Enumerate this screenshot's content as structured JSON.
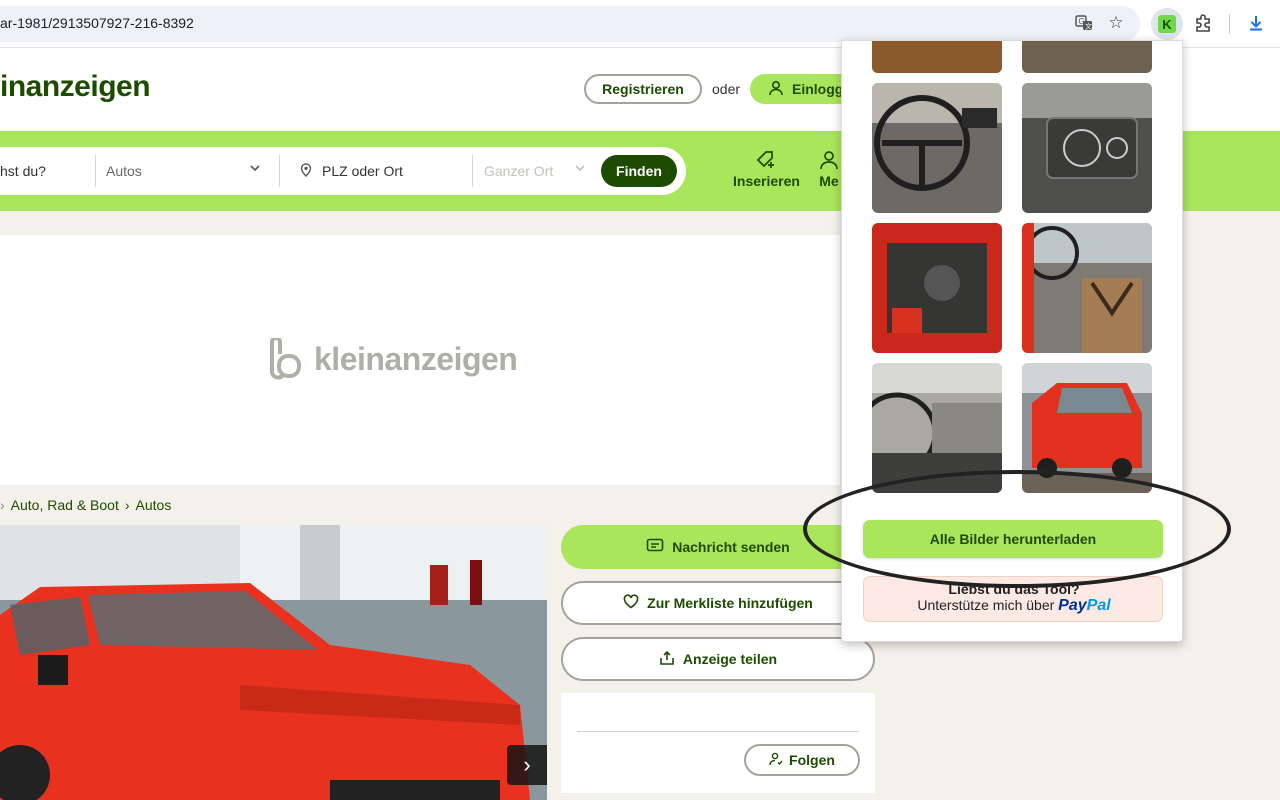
{
  "browser": {
    "url": "ar-1981/2913507927-216-8392",
    "icons": [
      "translate-icon",
      "bookmark-star-icon",
      "kleinanzeigen-extension-icon",
      "extensions-puzzle-icon",
      "download-icon"
    ],
    "extension_letter": "K"
  },
  "header": {
    "logo": "inanzeigen",
    "register_label": "Registrieren",
    "or_label": "oder",
    "login_label": "Einlogg"
  },
  "search": {
    "query_placeholder": "hst du?",
    "category_value": "Autos",
    "location_placeholder": "PLZ oder Ort",
    "radius_placeholder": "Ganzer Ort",
    "submit_label": "Finden"
  },
  "nav": {
    "post_label": "Inserieren",
    "my_label": "Me"
  },
  "ad": {
    "logo_text": "kleinanzeigen"
  },
  "breadcrumb": {
    "items": [
      "Auto, Rad & Boot",
      "Autos"
    ]
  },
  "actions": {
    "message_label": "Nachricht senden",
    "watchlist_label": "Zur Merkliste hinzufügen",
    "share_label": "Anzeige teilen",
    "follow_label": "Folgen"
  },
  "popup": {
    "thumbnails": [
      "steering-wheel-photo",
      "dashboard-gauges-photo",
      "engine-bay-photo",
      "interior-seats-photo",
      "dashboard-photo",
      "red-car-rear-photo"
    ],
    "download_label": "Alle Bilder herunterladen",
    "donate_heading": "Liebst du das Tool?",
    "donate_text": "Unterstütze mich über",
    "paypal_part1": "Pay",
    "paypal_part2": "Pal"
  },
  "colors": {
    "brand_green": "#a9e65b",
    "brand_dark": "#1d4b00",
    "background": "#f4f1ea"
  }
}
